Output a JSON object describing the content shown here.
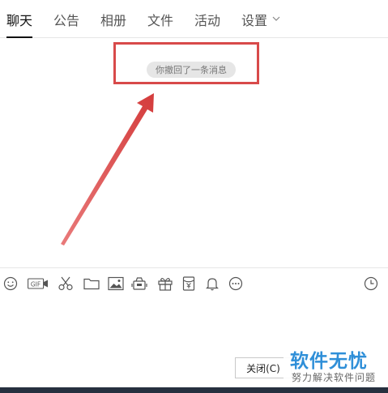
{
  "tabs": [
    {
      "label": "聊天",
      "active": true
    },
    {
      "label": "公告"
    },
    {
      "label": "相册"
    },
    {
      "label": "文件"
    },
    {
      "label": "活动"
    },
    {
      "label": "设置",
      "chevron": "chevron-down-icon"
    }
  ],
  "chat": {
    "recall_message": "你撤回了一条消息"
  },
  "annotation": {
    "highlight_color": "#d84a4a"
  },
  "toolbar": {
    "icons": [
      "emoji-icon",
      "gif-icon",
      "scissors-icon",
      "folder-icon",
      "image-icon",
      "shake-icon",
      "gift-icon",
      "red-packet-icon",
      "bell-icon",
      "more-icon",
      "history-clock-icon"
    ],
    "gif_text": "GIF"
  },
  "footer": {
    "close_label": "关闭(C)"
  },
  "watermark": {
    "title": "软件无忧",
    "subtitle": "努力解决软件问题",
    "color": "#2f8fd8"
  }
}
